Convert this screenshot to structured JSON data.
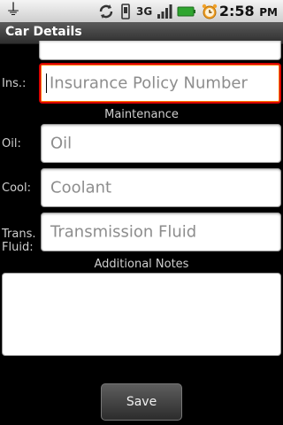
{
  "status_bar": {
    "network": "3G",
    "time": "2:58",
    "time_suffix": "PM"
  },
  "app": {
    "title": "Car Details"
  },
  "form": {
    "insurance": {
      "label": "Ins.:",
      "placeholder": "Insurance Policy Number"
    },
    "maintenance_heading": "Maintenance",
    "oil": {
      "label": "Oil:",
      "placeholder": "Oil"
    },
    "coolant": {
      "label": "Cool:",
      "placeholder": "Coolant"
    },
    "transmission": {
      "label_line1": "Trans.",
      "label_line2": "Fluid:",
      "placeholder": "Transmission Fluid"
    },
    "notes_heading": "Additional Notes",
    "save_label": "Save"
  },
  "colors": {
    "focus_border": "#d90000",
    "background": "#000000"
  }
}
